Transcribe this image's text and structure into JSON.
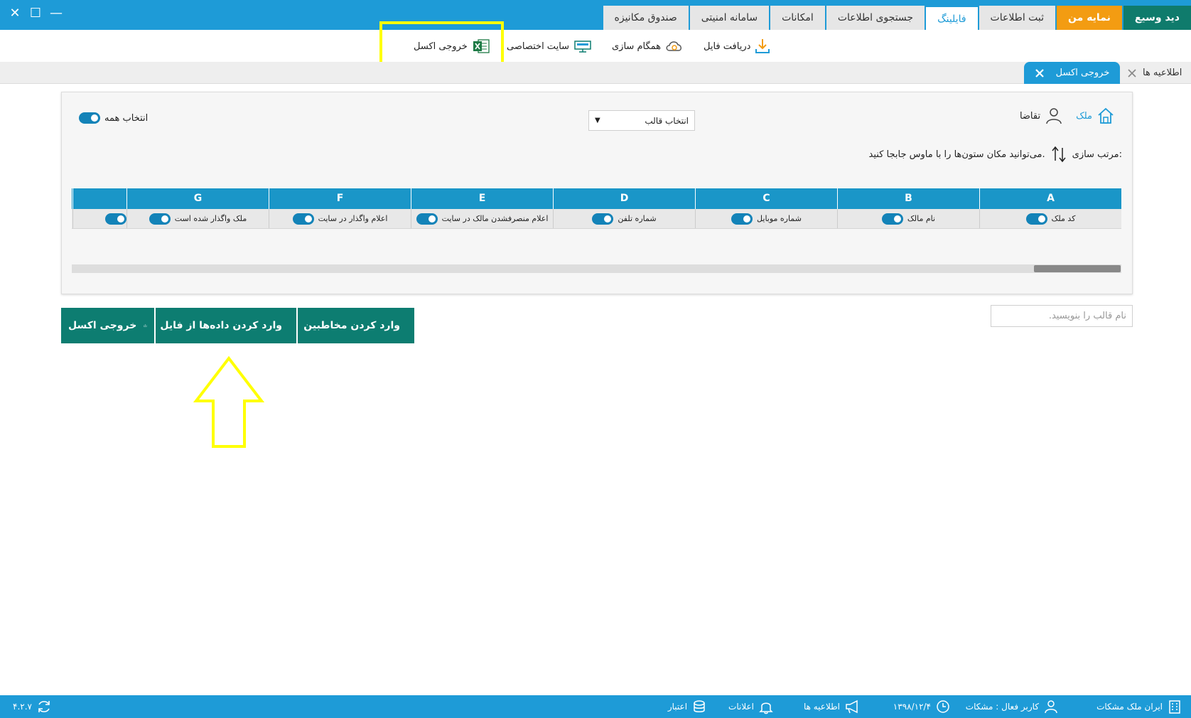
{
  "window": {
    "tabs": [
      {
        "label": "دید وسیع",
        "style": "green"
      },
      {
        "label": "نمایه من",
        "style": "orange"
      },
      {
        "label": "ثبت اطلاعات",
        "style": "normal"
      },
      {
        "label": "فایلینگ",
        "style": "active"
      },
      {
        "label": "جستجوی اطلاعات",
        "style": "normal"
      },
      {
        "label": "امکانات",
        "style": "normal"
      },
      {
        "label": "سامانه امنیتی",
        "style": "normal"
      },
      {
        "label": "صندوق مکانیزه",
        "style": "normal"
      }
    ],
    "controls": {
      "close": "✕",
      "maximize": "☐",
      "minimize": "—"
    }
  },
  "ribbon": {
    "download_file": "دریافت فایل",
    "sync": "همگام سازی",
    "dedicated_site": "سایت اختصاصی",
    "excel_export": "خروجی اکسل"
  },
  "doc_tabs": {
    "active": "خروجی اکسل",
    "notices": "اطلاعیه ها"
  },
  "panel": {
    "select_all": "انتخاب همه",
    "template_select": "انتخاب قالب",
    "type_property": "ملک",
    "type_request": "تقاضا",
    "sort_label": "مرتب سازی:",
    "sort_hint": "می‌توانید مکان ستون‌ها را با ماوس جابجا کنید.",
    "columns": [
      {
        "letter": "A",
        "label": "کد ملک"
      },
      {
        "letter": "B",
        "label": "نام مالک"
      },
      {
        "letter": "C",
        "label": "شماره موبایل"
      },
      {
        "letter": "D",
        "label": "شماره تلفن"
      },
      {
        "letter": "E",
        "label": "اعلام منصرفشدن مالک در سایت"
      },
      {
        "letter": "F",
        "label": "اعلام واگذار در سایت"
      },
      {
        "letter": "G",
        "label": "ملک واگذار شده است"
      }
    ]
  },
  "actions": {
    "excel_export": "خروجی اکسل",
    "import_from_file": "وارد کردن داده‌ها از فایل",
    "import_contacts": "وارد کردن مخاطبین",
    "template_name_placeholder": "نام قالب را بنویسید."
  },
  "status": {
    "company": "ایران ملک مشکات",
    "active_user": "کاربر فعال : مشکات",
    "date": "۱۳۹۸/۱۲/۴",
    "notices": "اطلاعیه ها",
    "alerts": "اعلانات",
    "credit": "اعتبار",
    "version": "۴.۲.۷"
  },
  "colors": {
    "primary": "#1e9bd7",
    "teal": "#0d7d71",
    "orange": "#f39c12",
    "highlight": "#ffff00"
  }
}
